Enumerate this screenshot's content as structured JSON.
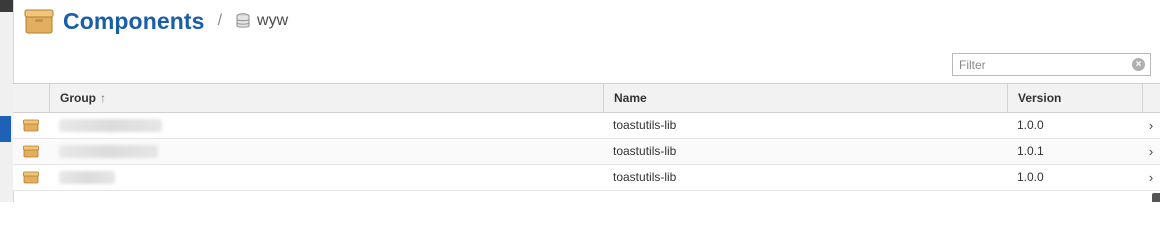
{
  "header": {
    "title": "Components",
    "separator": "/",
    "repository": "wyw"
  },
  "filter": {
    "placeholder": "Filter",
    "value": ""
  },
  "table": {
    "columns": [
      "Group",
      "Name",
      "Version"
    ],
    "sort_column": "Group",
    "sort_direction": "ascending",
    "rows": [
      {
        "group": "",
        "name": "toastutils-lib",
        "version": "1.0.0"
      },
      {
        "group": "",
        "name": "toastutils-lib",
        "version": "1.0.1"
      },
      {
        "group": "",
        "name": "toastutils-lib",
        "version": "1.0.0"
      }
    ]
  },
  "colors": {
    "title": "#1a5da8",
    "selection": "#1d62b6",
    "component_icon": "#e8b866"
  }
}
